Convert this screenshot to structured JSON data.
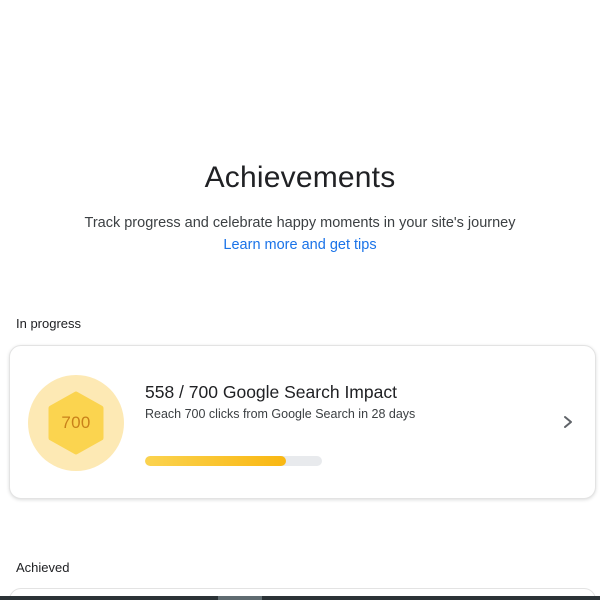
{
  "header": {
    "title": "Achievements",
    "subtitle": "Track progress and celebrate happy moments in your site's journey",
    "link_label": "Learn more and get tips"
  },
  "sections": {
    "in_progress_label": "In progress",
    "achieved_label": "Achieved"
  },
  "in_progress_card": {
    "badge_value": "700",
    "title": "558 / 700 Google Search Impact",
    "description": "Reach 700 clicks from Google Search in 28 days",
    "progress_current": 558,
    "progress_target": 700,
    "badge_color": "#fde9b4",
    "hex_color": "#fbd44f",
    "progress_color": "#f9b712",
    "icon": "chevron-right-icon"
  },
  "colors": {
    "link": "#1a73e8",
    "text": "#202124"
  }
}
